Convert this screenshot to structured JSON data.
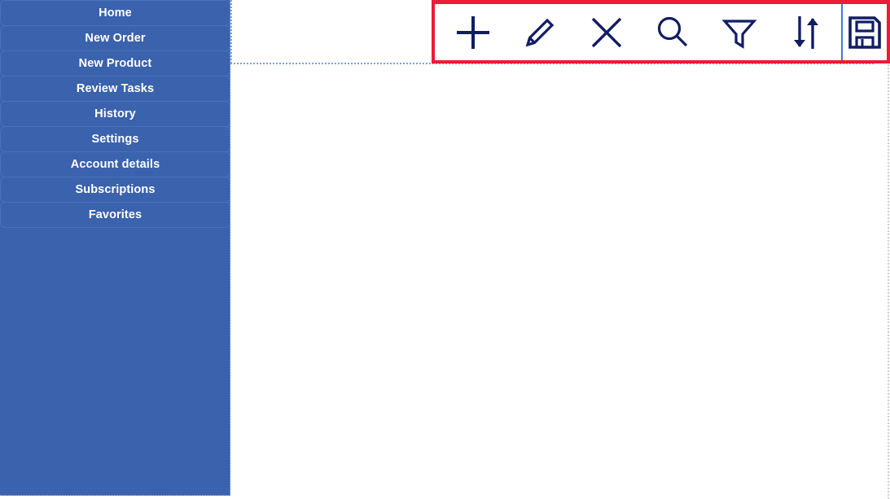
{
  "colors": {
    "sidebar_bg": "#3a62ad",
    "sidebar_item_border": "#4a70b8",
    "sidebar_text": "#ffffff",
    "icon_navy": "#111d63",
    "highlight_red": "#ed1b35",
    "divider_blue": "#3f7ccf",
    "guide_dotted_blue": "#7aa3dd",
    "content_bg": "#ffffff"
  },
  "sidebar": {
    "items": [
      {
        "label": "Home",
        "name": "sidebar-item-home"
      },
      {
        "label": "New Order",
        "name": "sidebar-item-new-order"
      },
      {
        "label": "New Product",
        "name": "sidebar-item-new-product"
      },
      {
        "label": "Review Tasks",
        "name": "sidebar-item-review-tasks"
      },
      {
        "label": "History",
        "name": "sidebar-item-history"
      },
      {
        "label": "Settings",
        "name": "sidebar-item-settings"
      },
      {
        "label": "Account details",
        "name": "sidebar-item-account-details"
      },
      {
        "label": "Subscriptions",
        "name": "sidebar-item-subscriptions"
      },
      {
        "label": "Favorites",
        "name": "sidebar-item-favorites"
      }
    ]
  },
  "toolbar": {
    "highlighted": true,
    "buttons": [
      {
        "icon": "plus-icon",
        "label": "Add"
      },
      {
        "icon": "pencil-icon",
        "label": "Edit"
      },
      {
        "icon": "close-icon",
        "label": "Delete"
      },
      {
        "icon": "search-icon",
        "label": "Search"
      },
      {
        "icon": "filter-icon",
        "label": "Filter"
      },
      {
        "icon": "sort-icon",
        "label": "Sort"
      },
      {
        "icon": "save-icon",
        "label": "Save"
      }
    ]
  },
  "main": {
    "content": ""
  }
}
